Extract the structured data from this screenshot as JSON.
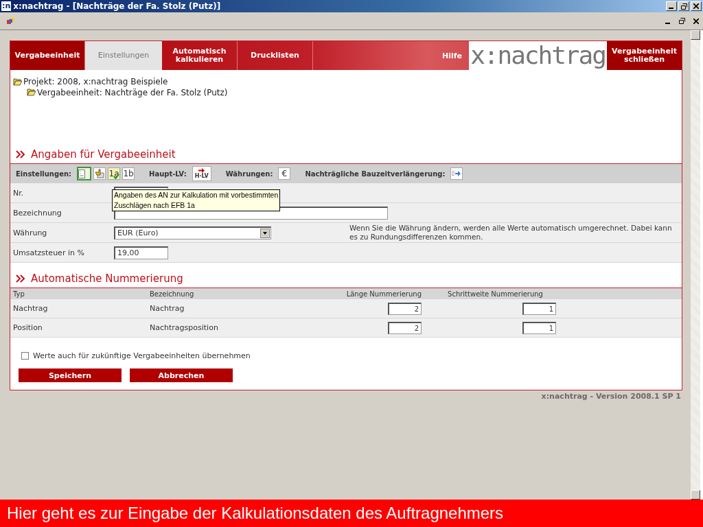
{
  "window": {
    "title": "x:nachtrag - [Nachträge der Fa. Stolz (Putz)]",
    "app_icon": ":n"
  },
  "nav": [
    {
      "label": "Vergabeeinheit",
      "selected": false
    },
    {
      "label": "Einstellungen",
      "selected": true
    },
    {
      "label": "Automatisch kalkulieren",
      "selected": false
    },
    {
      "label": "Drucklisten",
      "selected": false
    }
  ],
  "help": "Hilfe",
  "logo": "x:nachtrag",
  "close_unit": "Vergabeeinheit schließen",
  "tree": [
    {
      "label": "Projekt: 2008, x:nachtrag Beispiele",
      "children": [
        {
          "label": "Vergabeeinheit: Nachträge der Fa. Stolz (Putz)"
        }
      ]
    }
  ],
  "section1": {
    "title": "Angaben für Vergabeeinheit"
  },
  "toolbar": [
    {
      "label": "Einstellungen:",
      "buttons": [
        {
          "kind": "document",
          "selected": true
        },
        {
          "kind": "hand",
          "selected": false
        },
        {
          "kind": "text",
          "text": "1a",
          "selected": false,
          "checked": true
        },
        {
          "kind": "label",
          "text": "1b",
          "selected": false
        }
      ]
    },
    {
      "label": "Haupt-LV:",
      "buttons": [
        {
          "kind": "hlv",
          "text": "H·LV",
          "selected": false
        }
      ]
    },
    {
      "label": "Währungen:",
      "buttons": [
        {
          "kind": "label",
          "text": "€",
          "selected": false
        }
      ]
    },
    {
      "label": "Nachträgliche Bauzeitverlängerung:",
      "buttons": [
        {
          "kind": "extend",
          "selected": false
        }
      ]
    }
  ],
  "fields": [
    {
      "label": "Nr.",
      "kind": "short"
    },
    {
      "label": "Bezeichnung",
      "kind": "wide"
    },
    {
      "label": "Währung",
      "kind": "select",
      "value": "EUR (Euro)",
      "note": "Wenn Sie die Währung ändern, werden alle Werte automatisch umgerechnet. Dabei kann es zu Rundungsdifferenzen kommen."
    },
    {
      "label": "Umsatzsteuer in %",
      "kind": "short",
      "value": "19,00"
    }
  ],
  "tooltip": {
    "lines": [
      "Angaben des AN zur Kalkulation mit vorbestimmten",
      "Zuschlägen nach EFB 1a"
    ]
  },
  "section2": {
    "title": "Automatische Nummerierung"
  },
  "numbering": {
    "columns": [
      "Typ",
      "Bezeichnung",
      "Länge Nummerierung",
      "Schrittweite Nummerierung"
    ],
    "rows": [
      {
        "type": "Nachtrag",
        "name": "Nachtrag",
        "length": "2",
        "step": "1"
      },
      {
        "type": "Position",
        "name": "Nachtragsposition",
        "length": "2",
        "step": "1"
      }
    ]
  },
  "carry_over": {
    "label": "Werte auch für zukünftige Vergabeeinheiten übernehmen",
    "checked": false
  },
  "buttons": [
    "Speichern",
    "Abbrechen"
  ],
  "version": "x:nachtrag - Version 2008.1 SP 1",
  "banner": "Hier geht es zur Eingabe der Kalkulationsdaten des Auftragnehmers"
}
